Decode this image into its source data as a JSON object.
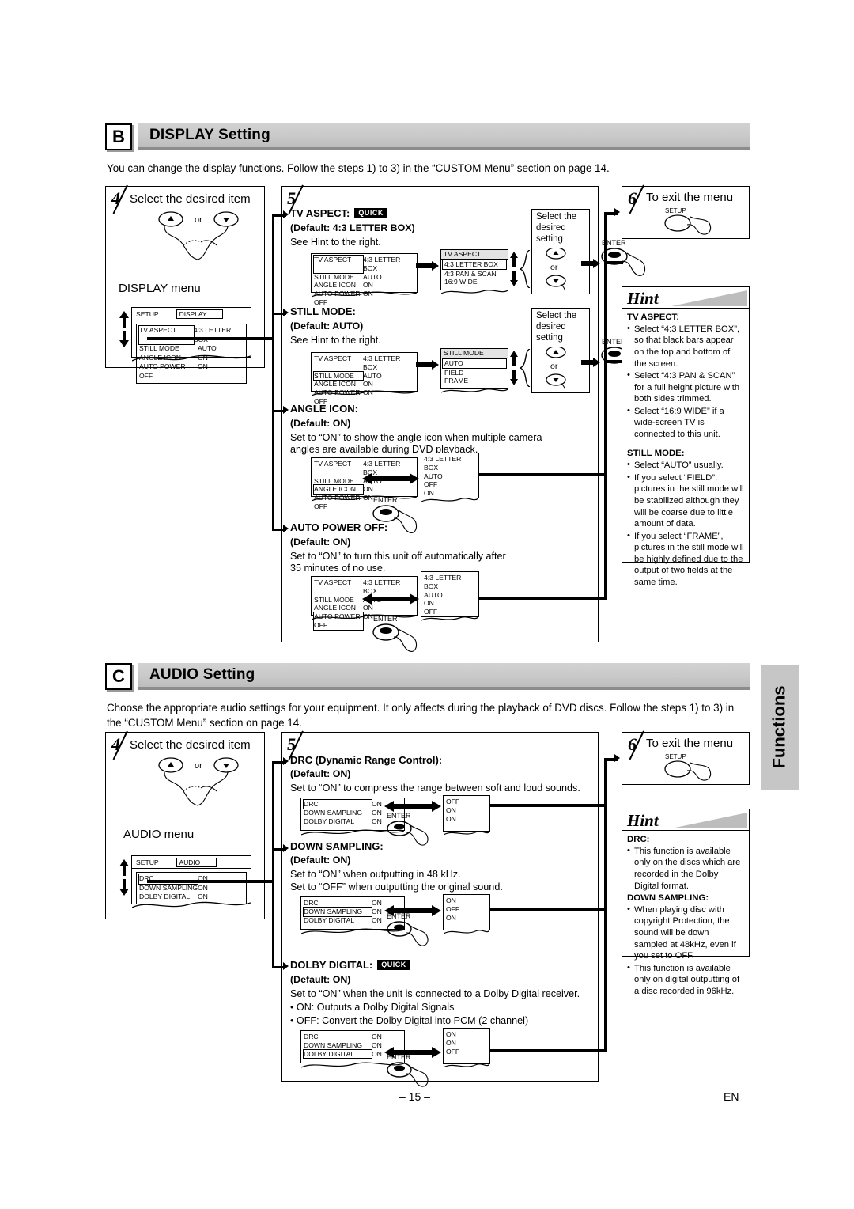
{
  "page": {
    "number": "– 15 –",
    "lang": "EN",
    "side_tab": "Functions"
  },
  "sections": [
    {
      "letter": "B",
      "title": "DISPLAY Setting",
      "intro": "You can change the display functions. Follow the steps 1) to 3) in the “CUSTOM Menu” section on page 14.",
      "step4": {
        "num": "4",
        "title": "Select the desired item",
        "or_label": "or",
        "menu_caption": "DISPLAY menu",
        "menu": {
          "setup_label": "SETUP",
          "tab_label": "DISPLAY",
          "rows": [
            {
              "k": "TV ASPECT",
              "v": "4:3 LETTER BOX",
              "highlight": true
            },
            {
              "k": "STILL MODE",
              "v": "AUTO",
              "highlight": false
            },
            {
              "k": "ANGLE ICON",
              "v": "ON",
              "highlight": false
            },
            {
              "k": "AUTO POWER OFF",
              "v": "ON",
              "highlight": false
            }
          ]
        }
      },
      "step5": {
        "num": "5"
      },
      "step6": {
        "num": "6",
        "title": "To exit the menu",
        "button": "SETUP"
      },
      "items": [
        {
          "name": "TV ASPECT:",
          "quick": "QUICK",
          "default": "(Default: 4:3 LETTER BOX)",
          "desc": [
            "See Hint to the right."
          ],
          "menu_rows": [
            {
              "k": "TV ASPECT",
              "v": "4:3 LETTER BOX",
              "highlight": true
            },
            {
              "k": "STILL MODE",
              "v": "AUTO",
              "highlight": false
            },
            {
              "k": "ANGLE ICON",
              "v": "ON",
              "highlight": false
            },
            {
              "k": "AUTO POWER OFF",
              "v": "ON",
              "highlight": false
            }
          ],
          "popup_title": "TV ASPECT",
          "options": [
            {
              "label": "4:3 LETTER BOX",
              "selected": true
            },
            {
              "label": "4:3 PAN & SCAN",
              "selected": false
            },
            {
              "label": "16:9 WIDE",
              "selected": false
            }
          ],
          "callout": "Select the desired setting",
          "or_label": "or",
          "enter_label": "ENTER"
        },
        {
          "name": "STILL MODE:",
          "quick": "",
          "default": "(Default: AUTO)",
          "desc": [
            "See Hint to the right."
          ],
          "menu_rows": [
            {
              "k": "TV ASPECT",
              "v": "4:3 LETTER BOX",
              "highlight": false
            },
            {
              "k": "STILL MODE",
              "v": "AUTO",
              "highlight": true
            },
            {
              "k": "ANGLE ICON",
              "v": "ON",
              "highlight": false
            },
            {
              "k": "AUTO POWER OFF",
              "v": "ON",
              "highlight": false
            }
          ],
          "popup_title": "STILL MODE",
          "options": [
            {
              "label": "AUTO",
              "selected": true
            },
            {
              "label": "FIELD",
              "selected": false
            },
            {
              "label": "FRAME",
              "selected": false
            }
          ],
          "callout": "Select the desired setting",
          "or_label": "or",
          "enter_label": "ENTER"
        },
        {
          "name": "ANGLE ICON:",
          "quick": "",
          "default": "(Default: ON)",
          "desc": [
            "Set to “ON” to show the angle icon when multiple camera",
            "angles are available during DVD playback."
          ],
          "menu_rows": [
            {
              "k": "TV ASPECT",
              "v": "4:3 LETTER BOX",
              "highlight": false
            },
            {
              "k": "STILL MODE",
              "v": "AUTO",
              "highlight": false
            },
            {
              "k": "ANGLE ICON",
              "v": "ON",
              "highlight": true
            },
            {
              "k": "AUTO POWER OFF",
              "v": "ON",
              "highlight": false
            }
          ],
          "toggle_values": [
            "4:3 LETTER BOX",
            "AUTO",
            "OFF",
            "ON"
          ],
          "enter_label": "ENTER"
        },
        {
          "name": "AUTO POWER OFF:",
          "quick": "",
          "default": "(Default: ON)",
          "desc": [
            "Set to “ON” to turn this unit off automatically after",
            "35 minutes of no use."
          ],
          "menu_rows": [
            {
              "k": "TV ASPECT",
              "v": "4:3 LETTER BOX",
              "highlight": false
            },
            {
              "k": "STILL MODE",
              "v": "AUTO",
              "highlight": false
            },
            {
              "k": "ANGLE ICON",
              "v": "ON",
              "highlight": false
            },
            {
              "k": "AUTO POWER OFF",
              "v": "ON",
              "highlight": true
            }
          ],
          "toggle_values": [
            "4:3 LETTER BOX",
            "AUTO",
            "ON",
            "OFF"
          ],
          "enter_label": "ENTER"
        }
      ],
      "hint": {
        "word": "Hint",
        "groups": [
          {
            "heading": "TV ASPECT:",
            "bullets": [
              "Select “4:3 LETTER BOX”, so that black bars appear on the top and bottom of the screen.",
              "Select “4:3 PAN & SCAN” for a full height picture with both sides trimmed.",
              "Select “16:9 WIDE” if a wide-screen TV is connected to this unit."
            ]
          },
          {
            "heading": "STILL MODE:",
            "bullets": [
              "Select “AUTO” usually.",
              "If you select “FIELD”, pictures in the still mode will be stabilized although they will be coarse due to little amount of data.",
              "If you select “FRAME”, pictures in the still mode will be highly defined due to the output of two fields at the same time."
            ]
          }
        ]
      }
    },
    {
      "letter": "C",
      "title": "AUDIO Setting",
      "intro": "Choose the appropriate audio settings for your equipment. It only affects during the playback of DVD discs. Follow the steps 1) to 3) in the “CUSTOM Menu” section on page 14.",
      "step4": {
        "num": "4",
        "title": "Select the desired item",
        "or_label": "or",
        "menu_caption": "AUDIO menu",
        "menu": {
          "setup_label": "SETUP",
          "tab_label": "AUDIO",
          "rows": [
            {
              "k": "DRC",
              "v": "ON",
              "highlight": true
            },
            {
              "k": "DOWN SAMPLING",
              "v": "ON",
              "highlight": false
            },
            {
              "k": "DOLBY DIGITAL",
              "v": "ON",
              "highlight": false
            }
          ]
        }
      },
      "step5": {
        "num": "5"
      },
      "step6": {
        "num": "6",
        "title": "To exit the menu",
        "button": "SETUP"
      },
      "items": [
        {
          "name": "DRC (Dynamic Range Control):",
          "quick": "",
          "default": "(Default: ON)",
          "desc": [
            "Set to “ON” to compress the range between soft and loud sounds."
          ],
          "menu_rows": [
            {
              "k": "DRC",
              "v": "ON",
              "highlight": true
            },
            {
              "k": "DOWN SAMPLING",
              "v": "ON",
              "highlight": false
            },
            {
              "k": "DOLBY DIGITAL",
              "v": "ON",
              "highlight": false
            }
          ],
          "toggle_values": [
            "OFF",
            "ON",
            "ON"
          ],
          "enter_label": "ENTER"
        },
        {
          "name": "DOWN SAMPLING:",
          "quick": "",
          "default": "(Default: ON)",
          "desc": [
            "Set to “ON” when outputting in 48 kHz.",
            "Set to “OFF” when outputting the original sound."
          ],
          "menu_rows": [
            {
              "k": "DRC",
              "v": "ON",
              "highlight": false
            },
            {
              "k": "DOWN SAMPLING",
              "v": "ON",
              "highlight": true
            },
            {
              "k": "DOLBY DIGITAL",
              "v": "ON",
              "highlight": false
            }
          ],
          "toggle_values": [
            "ON",
            "OFF",
            "ON"
          ],
          "enter_label": "ENTER"
        },
        {
          "name": "DOLBY DIGITAL:",
          "quick": "QUICK",
          "default": "(Default: ON)",
          "desc": [
            "Set to “ON” when the unit is connected to a Dolby Digital receiver.",
            "• ON: Outputs a Dolby Digital Signals",
            "• OFF: Convert the Dolby Digital into PCM (2 channel)"
          ],
          "menu_rows": [
            {
              "k": "DRC",
              "v": "ON",
              "highlight": false
            },
            {
              "k": "DOWN SAMPLING",
              "v": "ON",
              "highlight": false
            },
            {
              "k": "DOLBY DIGITAL",
              "v": "ON",
              "highlight": true
            }
          ],
          "toggle_values": [
            "ON",
            "ON",
            "OFF"
          ],
          "enter_label": "ENTER"
        }
      ],
      "hint": {
        "word": "Hint",
        "groups": [
          {
            "heading": "DRC:",
            "bullets": [
              "This function is available only on the discs which are recorded in the Dolby Digital format."
            ]
          },
          {
            "heading": "DOWN SAMPLING:",
            "bullets": [
              "When playing disc with copyright Protection, the sound will be down sampled at 48kHz, even if you set to OFF.",
              "This function is available only on digital outputting of a disc recorded in 96kHz."
            ]
          }
        ]
      }
    }
  ]
}
